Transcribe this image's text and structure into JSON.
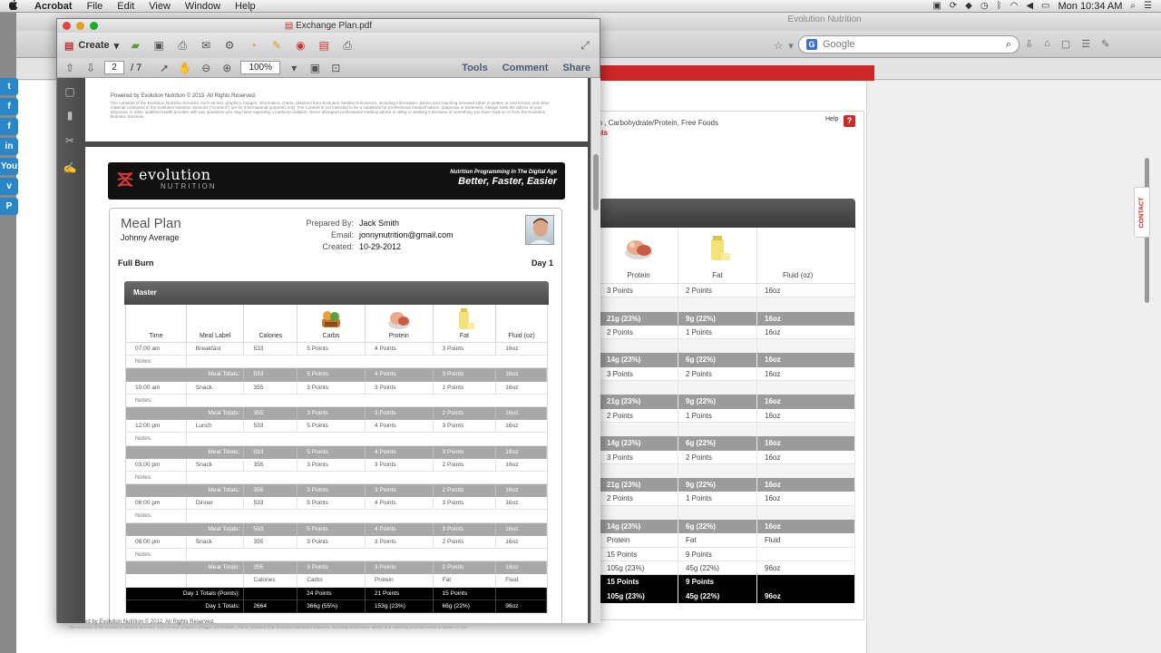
{
  "menubar": {
    "apple": "",
    "app": "Acrobat",
    "items": [
      "File",
      "Edit",
      "View",
      "Window",
      "Help"
    ],
    "clock": "Mon 10:34 AM"
  },
  "browser": {
    "title": "Evolution Nutrition",
    "search_engine": "G",
    "search_placeholder": "Google"
  },
  "sharebar": [
    "t",
    "f",
    "f",
    "in",
    "You",
    "v",
    "P"
  ],
  "contact_tab": "CONTACT",
  "webapp": {
    "subtitle": "tein , Carbohydrate/Protein, Free Foods",
    "points_label": "oints",
    "help": "Help",
    "help_icon": "?",
    "col_protein": "Protein",
    "col_fat": "Fat",
    "col_fluid": "Fluid (oz)",
    "rows": [
      {
        "type": "wh",
        "a": "3 Points",
        "b": "2 Points",
        "c": "16oz"
      },
      {
        "type": "blank",
        "a": "",
        "b": "",
        "c": ""
      },
      {
        "type": "gy",
        "a": "21g (23%)",
        "b": "9g (22%)",
        "c": "16oz"
      },
      {
        "type": "wh",
        "a": "2 Points",
        "b": "1 Points",
        "c": "16oz"
      },
      {
        "type": "blank",
        "a": "",
        "b": "",
        "c": ""
      },
      {
        "type": "gy",
        "a": "14g (23%)",
        "b": "6g (22%)",
        "c": "16oz"
      },
      {
        "type": "wh",
        "a": "3 Points",
        "b": "2 Points",
        "c": "16oz"
      },
      {
        "type": "blank",
        "a": "",
        "b": "",
        "c": ""
      },
      {
        "type": "gy",
        "a": "21g (23%)",
        "b": "9g (22%)",
        "c": "16oz"
      },
      {
        "type": "wh",
        "a": "2 Points",
        "b": "1 Points",
        "c": "16oz"
      },
      {
        "type": "blank",
        "a": "",
        "b": "",
        "c": ""
      },
      {
        "type": "gy",
        "a": "14g (23%)",
        "b": "6g (22%)",
        "c": "16oz"
      },
      {
        "type": "wh",
        "a": "3 Points",
        "b": "2 Points",
        "c": "16oz"
      },
      {
        "type": "blank",
        "a": "",
        "b": "",
        "c": ""
      },
      {
        "type": "gy",
        "a": "21g (23%)",
        "b": "9g (22%)",
        "c": "16oz"
      },
      {
        "type": "wh",
        "a": "2 Points",
        "b": "1 Points",
        "c": "16oz"
      },
      {
        "type": "blank",
        "a": "",
        "b": "",
        "c": ""
      },
      {
        "type": "gy",
        "a": "14g (23%)",
        "b": "6g (22%)",
        "c": "16oz"
      },
      {
        "type": "wh",
        "a": "Protein",
        "b": "Fat",
        "c": "Fluid"
      },
      {
        "type": "wh",
        "a": "15 Points",
        "b": "9 Points",
        "c": ""
      },
      {
        "type": "wh",
        "a": "105g (23%)",
        "b": "45g (22%)",
        "c": "96oz"
      },
      {
        "type": "bk",
        "a": "15 Points",
        "b": "9 Points",
        "c": ""
      },
      {
        "type": "bk",
        "a": "105g (23%)",
        "b": "45g (22%)",
        "c": "96oz"
      }
    ]
  },
  "acrobat": {
    "title": "Exchange Plan.pdf",
    "create": "Create",
    "page_current": "2",
    "page_total": "/ 7",
    "zoom": "100%",
    "tabs": [
      "Tools",
      "Comment",
      "Share"
    ]
  },
  "pdf": {
    "powered_by": "Powered by Evolution Nutrition © 2013. All Rights Reserved.",
    "disclaimer": "The contents of the Evolution Nutrition Services, such as text, graphics, images, information, charts, obtained from Evolution Nutrition's licensors, including information, advice and coaching received either in written or oral format, and other material contained in the Evolution Nutrition Services (\"Content\") are for informational purposes only. The Content is not intended to be a substitute for professional medical advice, diagnosis or treatment. Always seek the advice of your physician or other qualified health provider with any questions you may have regarding a medical condition. Never disregard professional medical advice or delay in seeking it because of something you have read on or from the Evolution Nutrition Services.",
    "logo_line1": "evolution",
    "logo_line2": "NUTRITION",
    "tagline_small": "Nutrition Programming In The Digital Age",
    "tagline_big": "Better, Faster, Easier",
    "meal_plan_title": "Meal Plan",
    "client_name": "Johnny Average",
    "prepared_by_label": "Prepared By:",
    "prepared_by": "Jack Smith",
    "email_label": "Email:",
    "email": "jonnynutrition@gmail.com",
    "created_label": "Created:",
    "created": "10-29-2012",
    "plan_name": "Full Burn",
    "day": "Day 1",
    "master": "Master",
    "headers": [
      "Time",
      "Meal Label",
      "Calories",
      "Carbs",
      "Protein",
      "Fat",
      "Fluid (oz)"
    ],
    "meals": [
      {
        "time": "07:00 am",
        "label": "Breakfast",
        "cal": "533",
        "carbs": "5 Points",
        "protein": "4 Points",
        "fat": "3 Points",
        "fluid": "16oz",
        "notes": "Notes:",
        "tot_label": "Meal Totals:",
        "t_cal": "533",
        "t_carbs": "5 Points",
        "t_protein": "4 Points",
        "t_fat": "3 Points",
        "t_fluid": "16oz"
      },
      {
        "time": "10:00 am",
        "label": "Snack",
        "cal": "355",
        "carbs": "3 Points",
        "protein": "3 Points",
        "fat": "2 Points",
        "fluid": "16oz",
        "notes": "Notes:",
        "tot_label": "Meal Totals:",
        "t_cal": "355",
        "t_carbs": "3 Points",
        "t_protein": "3 Points",
        "t_fat": "2 Points",
        "t_fluid": "16oz"
      },
      {
        "time": "12:00 pm",
        "label": "Lunch",
        "cal": "533",
        "carbs": "5 Points",
        "protein": "4 Points",
        "fat": "3 Points",
        "fluid": "16oz",
        "notes": "Notes:",
        "tot_label": "Meal Totals:",
        "t_cal": "533",
        "t_carbs": "5 Points",
        "t_protein": "4 Points",
        "t_fat": "3 Points",
        "t_fluid": "16oz"
      },
      {
        "time": "03:00 pm",
        "label": "Snack",
        "cal": "355",
        "carbs": "3 Points",
        "protein": "3 Points",
        "fat": "2 Points",
        "fluid": "16oz",
        "notes": "Notes:",
        "tot_label": "Meal Totals:",
        "t_cal": "355",
        "t_carbs": "3 Points",
        "t_protein": "3 Points",
        "t_fat": "2 Points",
        "t_fluid": "16oz"
      },
      {
        "time": "06:00 pm",
        "label": "Dinner",
        "cal": "533",
        "carbs": "5 Points",
        "protein": "4 Points",
        "fat": "3 Points",
        "fluid": "16oz",
        "notes": "Notes:",
        "tot_label": "Meal Totals:",
        "t_cal": "533",
        "t_carbs": "5 Points",
        "t_protein": "4 Points",
        "t_fat": "3 Points",
        "t_fluid": "16oz"
      },
      {
        "time": "08:00 pm",
        "label": "Snack",
        "cal": "355",
        "carbs": "3 Points",
        "protein": "3 Points",
        "fat": "2 Points",
        "fluid": "16oz",
        "notes": "Notes:",
        "tot_label": "Meal Totals:",
        "t_cal": "355",
        "t_carbs": "3 Points",
        "t_protein": "3 Points",
        "t_fat": "2 Points",
        "t_fluid": "16oz"
      }
    ],
    "summary_headers": [
      "Calories",
      "Carbs",
      "Protein",
      "Fat",
      "Fluid"
    ],
    "points_row": {
      "label": "Day 1 Totals (Points):",
      "cal": "",
      "carbs": "24 Points",
      "protein": "21 Points",
      "fat": "15 Points",
      "fluid": ""
    },
    "totals_row": {
      "label": "Day 1 Totals:",
      "cal": "2664",
      "carbs": "366g (55%)",
      "protein": "153g (23%)",
      "fat": "66g (22%)",
      "fluid": "96oz"
    },
    "footer_powered": "Powered by Evolution Nutrition © 2012. All Rights Reserved.",
    "footer_disc": "The contents of the Evolution Nutrition Services, such as text, graphics, images, information, charts, obtained from Evolution Nutrition's licensors, including information, advice and coaching received either in written or oral"
  }
}
